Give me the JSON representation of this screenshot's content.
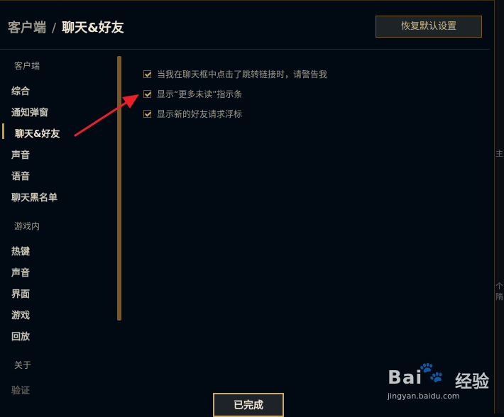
{
  "header": {
    "crumb": "客户端",
    "separator": "/",
    "title": "聊天&好友",
    "restore_label": "恢复默认设置"
  },
  "sidebar": {
    "client_section": "客户端",
    "client_items": [
      "综合",
      "通知弹窗",
      "聊天&好友",
      "声音",
      "语音",
      "聊天黑名单"
    ],
    "active_item": "聊天&好友",
    "ingame_section": "游戏内",
    "ingame_items": [
      "热键",
      "声音",
      "界面",
      "游戏",
      "回放"
    ],
    "about_section": "关于",
    "about_items": [
      "验证"
    ]
  },
  "options": [
    {
      "label": "当我在聊天框中点击了跳转链接时，请警告我",
      "checked": true
    },
    {
      "label": "显示“更多未读”指示条",
      "checked": true
    },
    {
      "label": "显示新的好友请求浮标",
      "checked": true
    }
  ],
  "footer": {
    "done_label": "已完成"
  },
  "watermark": {
    "brand": "Bai",
    "paw": "🐾",
    "brand_cn": "经验",
    "url": "jingyan.baidu.com"
  },
  "colors": {
    "background": "#010a13",
    "gold": "#c8aa6e",
    "arrow": "#e8202a"
  }
}
